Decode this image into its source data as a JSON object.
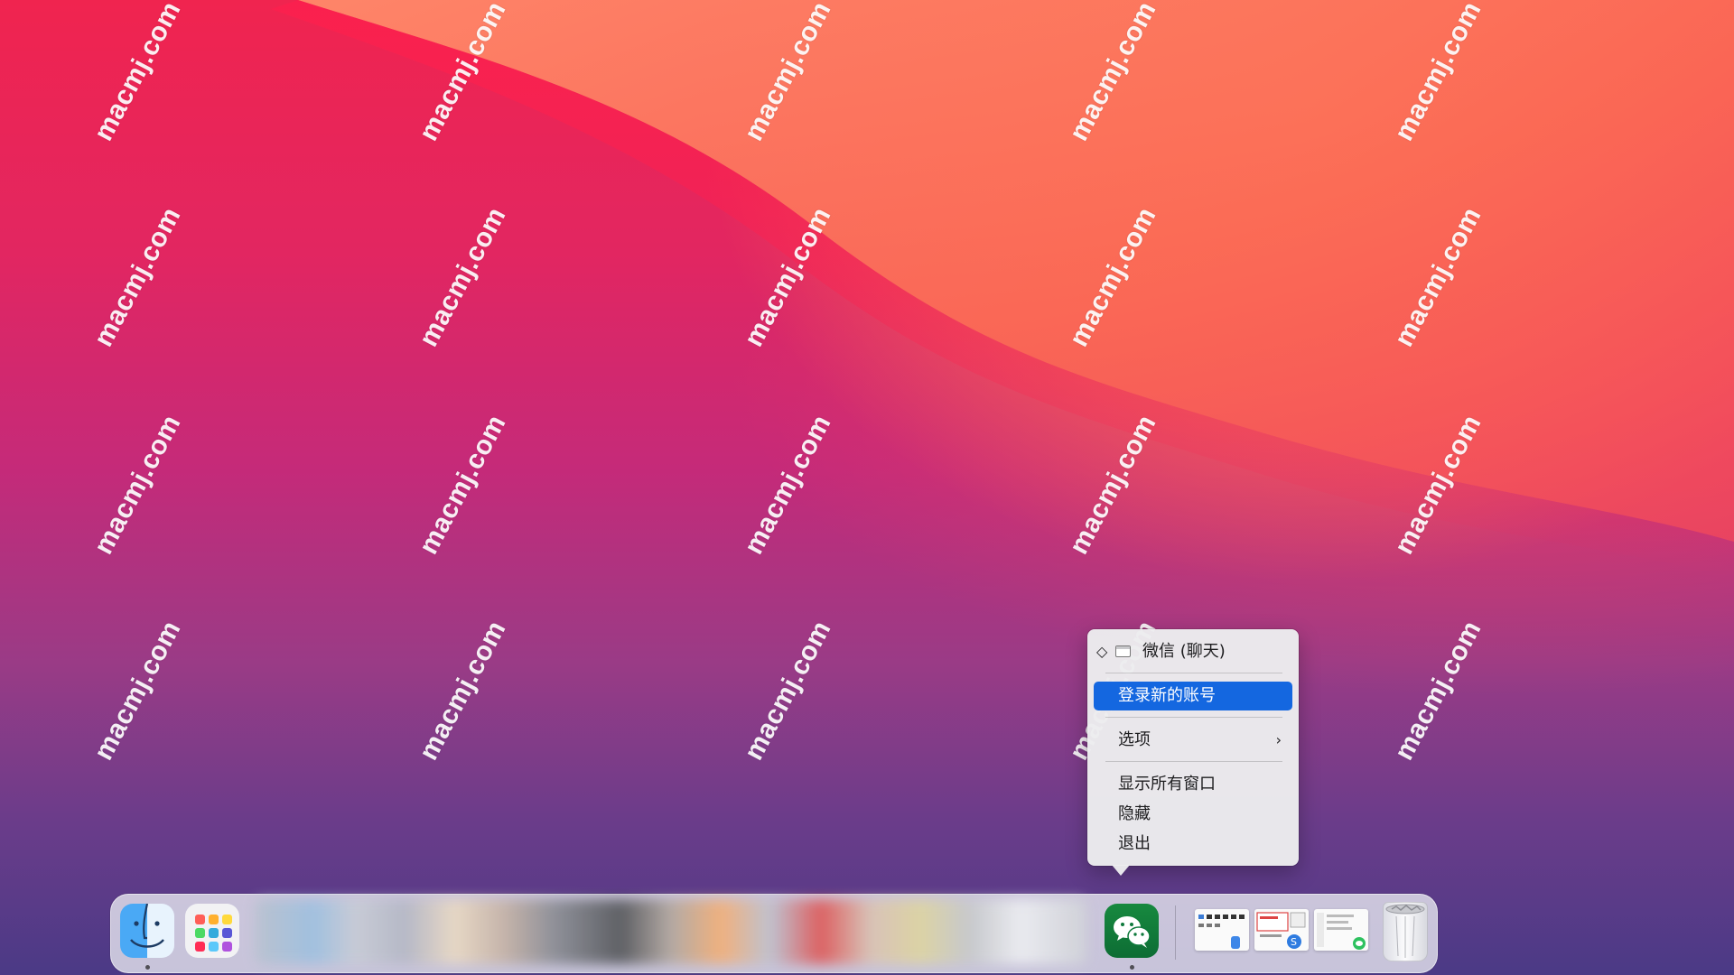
{
  "watermark": {
    "text": "macmj.com"
  },
  "dock": {
    "apps": [
      {
        "name": "Finder",
        "icon": "finder-icon",
        "running": true
      },
      {
        "name": "Launchpad",
        "icon": "launchpad-icon",
        "running": false
      },
      {
        "name": "WeChat",
        "icon": "wechat-icon",
        "running": true
      }
    ],
    "blurred_region": "pixelated-apps",
    "recent_windows": [
      "window-thumbnail-1",
      "window-thumbnail-2",
      "window-thumbnail-3"
    ],
    "trash": "trash-icon"
  },
  "context_menu": {
    "window_item": {
      "marker": "◇",
      "icon": "window-icon",
      "label": "微信 (聊天)"
    },
    "login_new_account": "登录新的账号",
    "options": "选项",
    "options_chevron": "›",
    "show_all_windows": "显示所有窗口",
    "hide": "隐藏",
    "quit": "退出"
  },
  "colors": {
    "menu_highlight": "#1467e0",
    "wechat_green": "#0f7a3c"
  }
}
